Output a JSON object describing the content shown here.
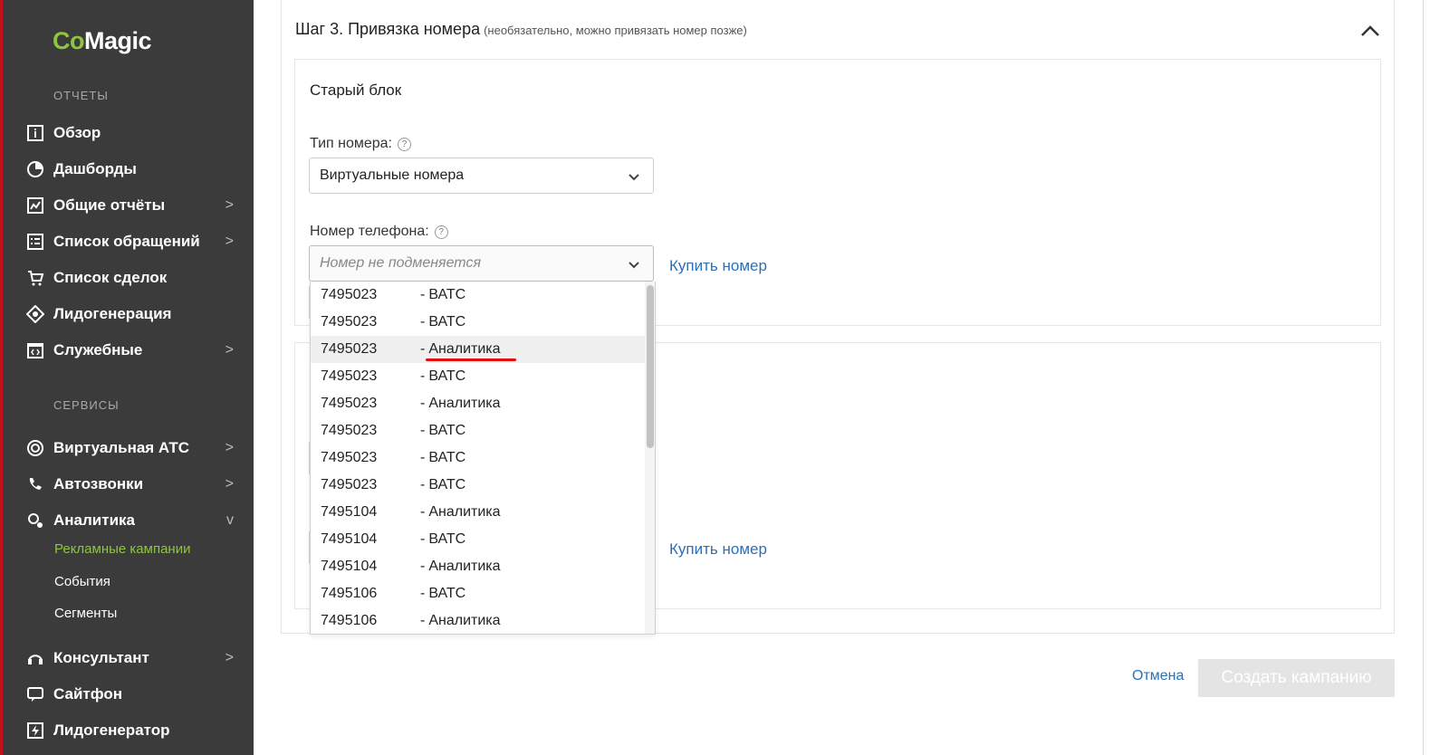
{
  "sidebar": {
    "logo": {
      "co": "Co",
      "magic": "Magic"
    },
    "reports_title": "ОТЧЕТЫ",
    "services_title": "СЕРВИСЫ",
    "items": [
      {
        "label": "Обзор",
        "icon": "info-icon",
        "arrow": ""
      },
      {
        "label": "Дашборды",
        "icon": "pie-chart-icon",
        "arrow": ""
      },
      {
        "label": "Общие отчёты",
        "icon": "line-chart-icon",
        "arrow": ">"
      },
      {
        "label": "Список обращений",
        "icon": "list-icon",
        "arrow": ">"
      },
      {
        "label": "Список сделок",
        "icon": "cart-icon",
        "arrow": ""
      },
      {
        "label": "Лидогенерация",
        "icon": "lead-icon",
        "arrow": ""
      },
      {
        "label": "Служебные",
        "icon": "code-icon",
        "arrow": ">"
      },
      {
        "label": "Виртуальная АТС",
        "icon": "pbx-icon",
        "arrow": ">"
      },
      {
        "label": "Автозвонки",
        "icon": "autocall-icon",
        "arrow": ">"
      },
      {
        "label": "Аналитика",
        "icon": "analytics-icon",
        "arrow": "v"
      },
      {
        "label": "Консультант",
        "icon": "consultant-icon",
        "arrow": ">"
      },
      {
        "label": "Сайтфон",
        "icon": "sitephone-icon",
        "arrow": ""
      },
      {
        "label": "Лидогенератор",
        "icon": "leadgen-icon",
        "arrow": ""
      }
    ],
    "analytics_sub": [
      "Рекламные кампании",
      "События",
      "Сегменты"
    ]
  },
  "step": {
    "title": "Шаг 3. Привязка номера",
    "note": "(необязательно, можно привязать номер позже)"
  },
  "block": {
    "title": "Старый блок",
    "type_label": "Тип номера:",
    "type_value": "Виртуальные номера",
    "phone_label": "Номер телефона:",
    "phone_placeholder": "Номер не подменяется",
    "buy_link": "Купить номер",
    "buy_link_2": "Купить номер"
  },
  "dropdown": {
    "options": [
      {
        "number": "7495023",
        "type": "ВАТС"
      },
      {
        "number": "7495023",
        "type": "ВАТС"
      },
      {
        "number": "7495023",
        "type": "Аналитика"
      },
      {
        "number": "7495023",
        "type": "ВАТС"
      },
      {
        "number": "7495023",
        "type": "Аналитика"
      },
      {
        "number": "7495023",
        "type": "ВАТС"
      },
      {
        "number": "7495023",
        "type": "ВАТС"
      },
      {
        "number": "7495023",
        "type": "ВАТС"
      },
      {
        "number": "7495104",
        "type": "Аналитика"
      },
      {
        "number": "7495104",
        "type": "ВАТС"
      },
      {
        "number": "7495104",
        "type": "Аналитика"
      },
      {
        "number": "7495106",
        "type": "ВАТС"
      },
      {
        "number": "7495106",
        "type": "Аналитика"
      }
    ],
    "separator": "-"
  },
  "footer": {
    "cancel": "Отмена",
    "create": "Создать кампанию"
  },
  "colors": {
    "sidebar_bg": "#3b3b3b",
    "accent_green": "#8dc63f",
    "link_blue": "#2d6fb5",
    "highlight_red": "#e01010"
  }
}
